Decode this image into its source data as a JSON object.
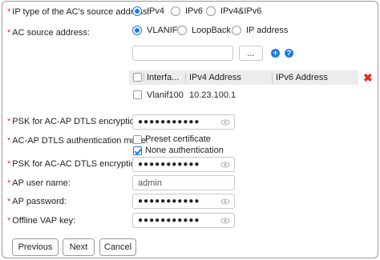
{
  "form": {
    "ip_type": {
      "label": "IP type of the AC's source address:",
      "options": [
        "IPv4",
        "IPv6",
        "IPv4&IPv6"
      ],
      "selected": "IPv4"
    },
    "ac_source": {
      "label": "AC source address:",
      "options": [
        "VLANIF",
        "LoopBack",
        "IP address"
      ],
      "selected": "VLANIF",
      "input_value": "",
      "browse_label": "...",
      "add_icon": "+",
      "help_icon": "?"
    },
    "table": {
      "headers": [
        "Interfa...",
        "IPv4 Address",
        "IPv6 Address"
      ],
      "rows": [
        {
          "interface": "Vlanif100",
          "ipv4": "10.23.100.1",
          "ipv6": ""
        }
      ],
      "delete_icon": "✖"
    },
    "psk_ac_ap": {
      "label": "PSK for AC-AP DTLS encryption:",
      "value": "●●●●●●●●●●●"
    },
    "auth_mode": {
      "label": "AC-AP DTLS authentication mode:",
      "options": [
        {
          "label": "Preset certificate",
          "checked": false
        },
        {
          "label": "None authentication",
          "checked": true
        }
      ]
    },
    "psk_ac_ac": {
      "label": "PSK for AC-AC DTLS encryption:",
      "value": "●●●●●●●●●●●"
    },
    "ap_user": {
      "label": "AP user name:",
      "value": "admin"
    },
    "ap_password": {
      "label": "AP password:",
      "value": "●●●●●●●●●●●"
    },
    "offline_vap": {
      "label": "Offline VAP key:",
      "value": "●●●●●●●●●●●"
    },
    "required_mark": "*"
  },
  "footer": {
    "previous_label": "Previous",
    "next_label": "Next",
    "cancel_label": "Cancel"
  },
  "colors": {
    "accent": "#1d7be6",
    "required": "#e0301e",
    "table_header": "#ececec"
  },
  "icons": {
    "eye": "eye-icon",
    "delete": "delete-x-icon",
    "add": "add-circle-icon",
    "help": "help-circle-icon"
  }
}
